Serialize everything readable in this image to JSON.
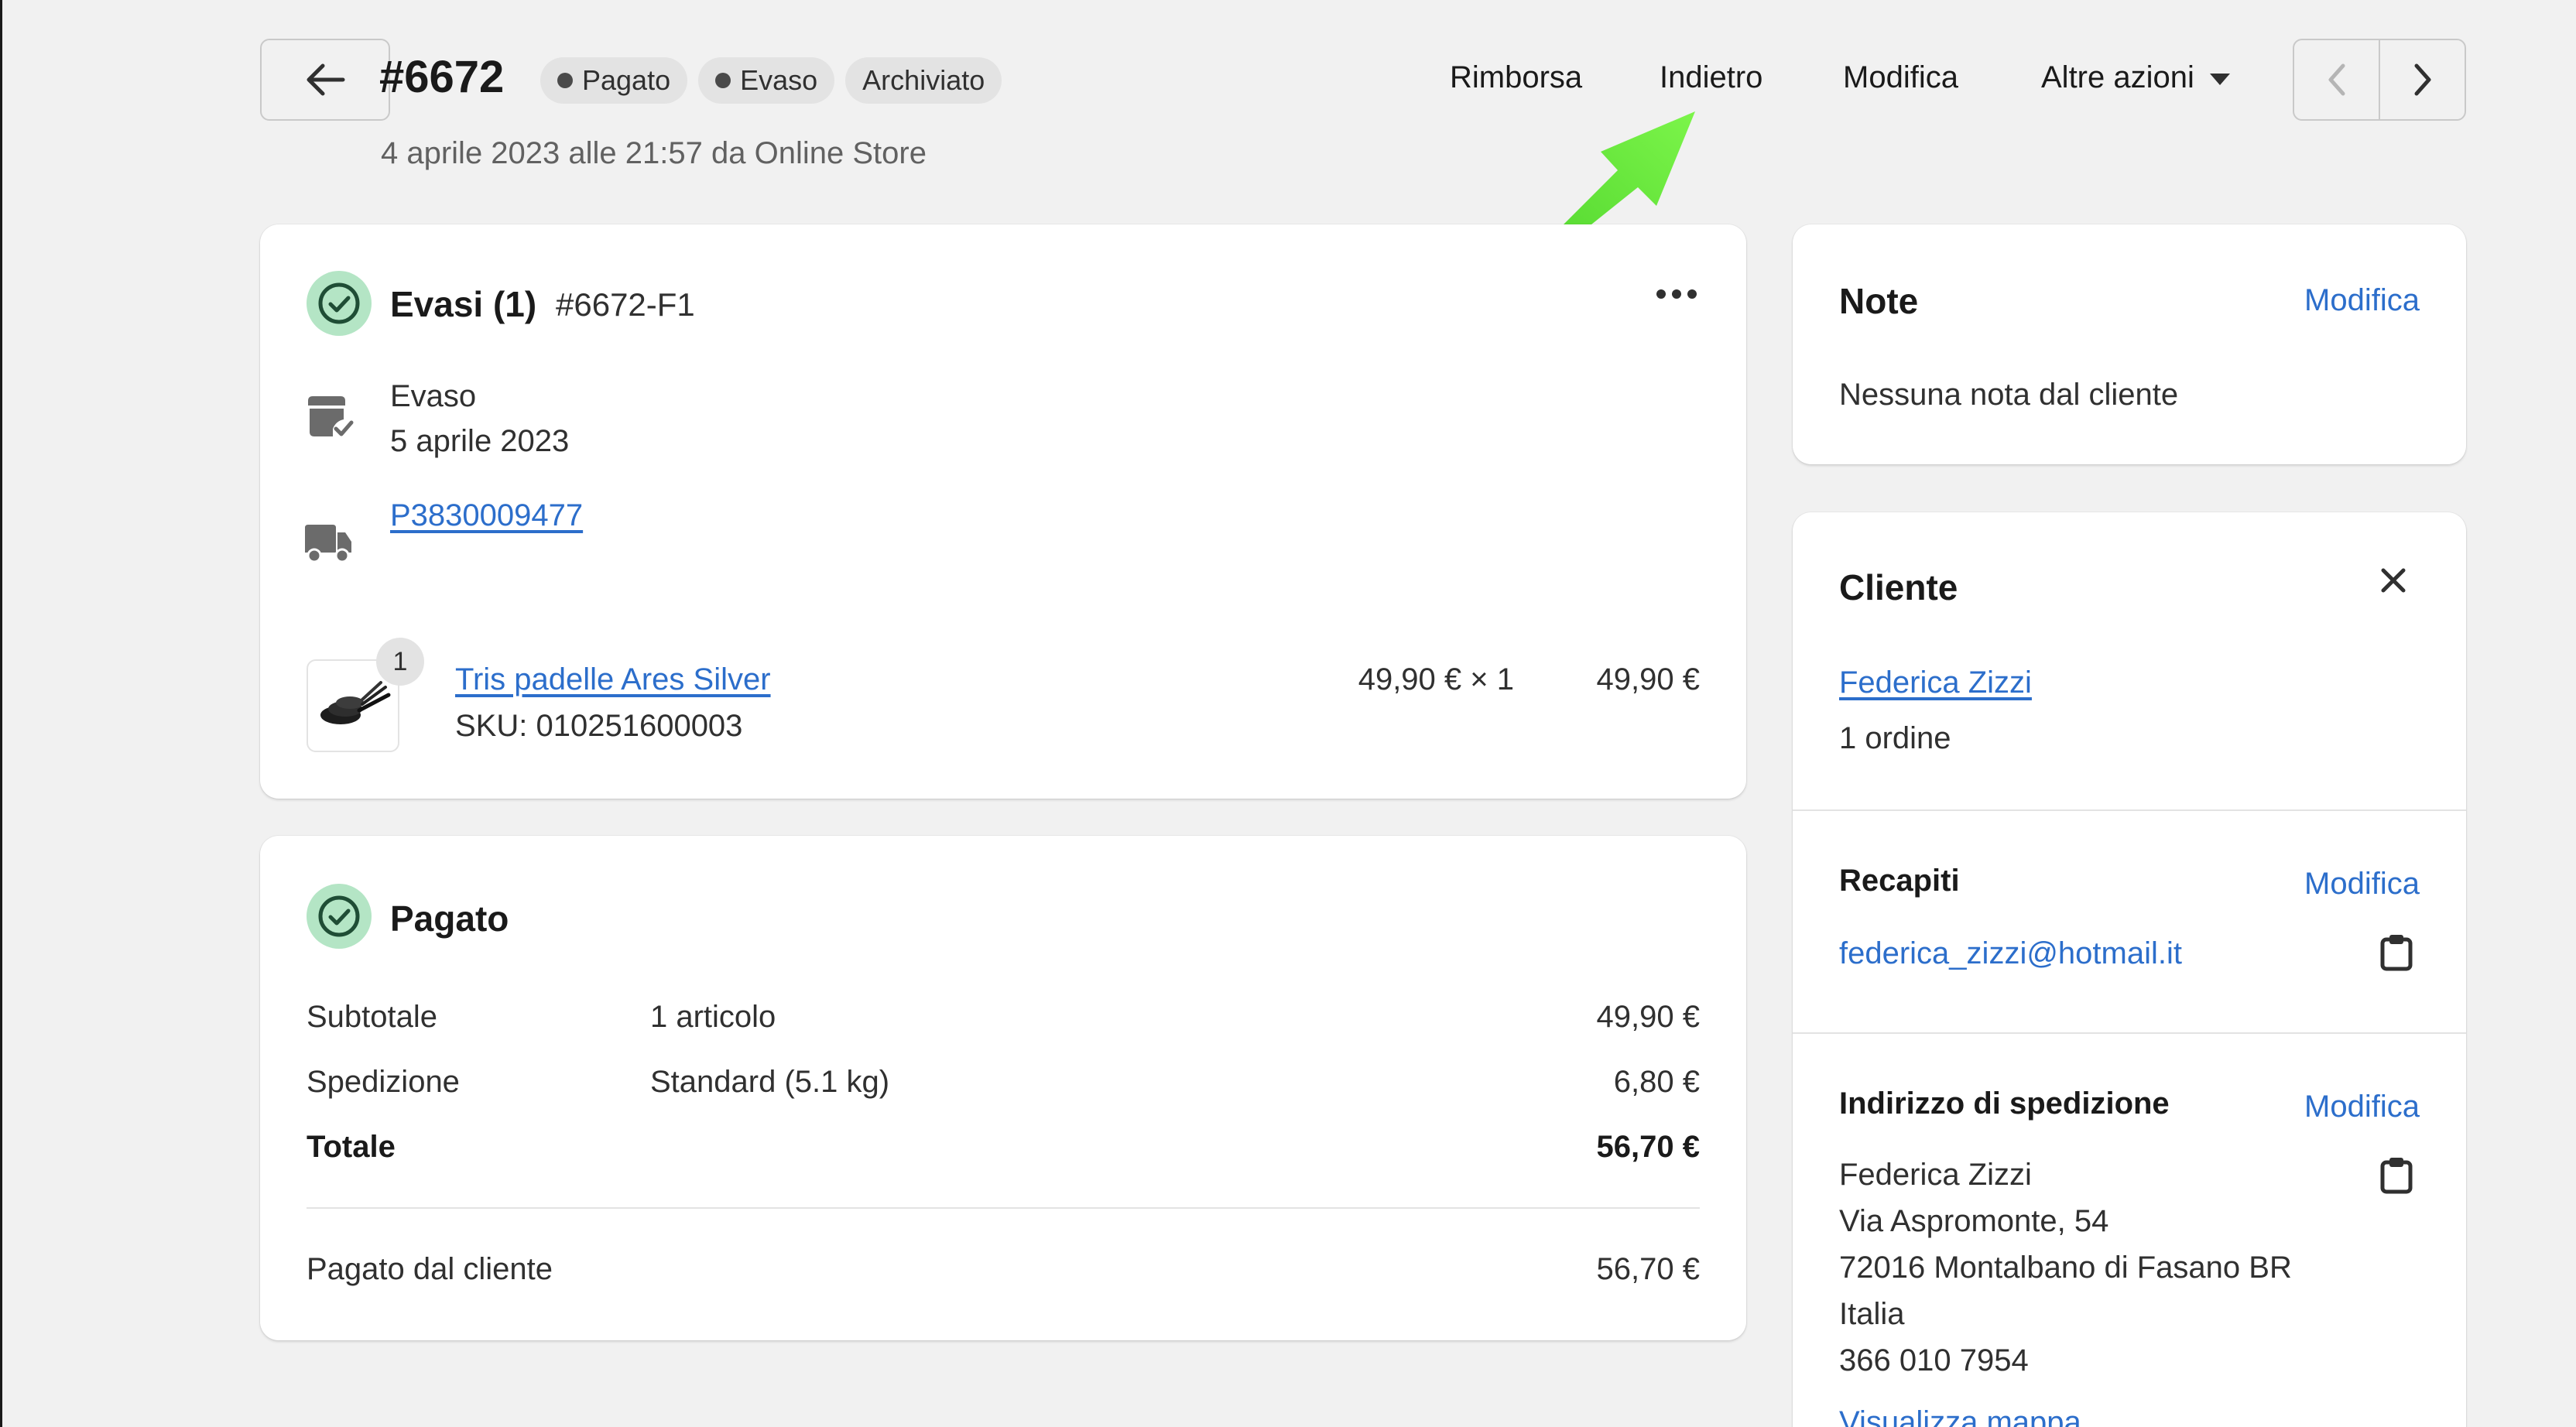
{
  "header": {
    "order_number": "#6672",
    "badges": [
      {
        "label": "Pagato",
        "dot": true
      },
      {
        "label": "Evaso",
        "dot": true
      },
      {
        "label": "Archiviato",
        "dot": false
      }
    ],
    "subtitle": "4 aprile 2023 alle 21:57 da Online Store",
    "actions": {
      "refund": "Rimborsa",
      "back": "Indietro",
      "edit": "Modifica",
      "more": "Altre azioni"
    }
  },
  "fulfillment": {
    "title": "Evasi (1)",
    "fulfillment_id": "#6672-F1",
    "status_label": "Evaso",
    "status_date": "5 aprile 2023",
    "tracking_number": "P3830009477",
    "item": {
      "quantity_badge": "1",
      "name": "Tris padelle Ares Silver",
      "sku": "SKU: 010251600003",
      "unit_price": "49,90 € × 1",
      "total": "49,90 €"
    }
  },
  "payment": {
    "title": "Pagato",
    "rows": [
      {
        "label": "Subtotale",
        "detail": "1 articolo",
        "amount": "49,90 €"
      },
      {
        "label": "Spedizione",
        "detail": "Standard (5.1 kg)",
        "amount": "6,80 €"
      },
      {
        "label": "Totale",
        "detail": "",
        "amount": "56,70 €"
      }
    ],
    "paid_by_customer_label": "Pagato dal cliente",
    "paid_by_customer_amount": "56,70 €"
  },
  "note": {
    "title": "Note",
    "edit": "Modifica",
    "text": "Nessuna nota dal cliente"
  },
  "customer": {
    "title": "Cliente",
    "name": "Federica Zizzi",
    "orders": "1 ordine",
    "contacts_title": "Recapiti",
    "contacts_edit": "Modifica",
    "email": "federica_zizzi@hotmail.it",
    "shipping_title": "Indirizzo di spedizione",
    "shipping_edit": "Modifica",
    "address_lines": [
      "Federica Zizzi",
      "Via Aspromonte, 54",
      "72016 Montalbano di Fasano BR",
      "Italia",
      "366 010 7954"
    ],
    "map_link": "Visualizza mappa"
  },
  "colors": {
    "accent_link": "#2c6ecb",
    "success_circle": "#b4e5c5",
    "annotation_arrow": "#5fe03a"
  },
  "icons": [
    "back-arrow-icon",
    "chevron-left-icon",
    "chevron-right-icon",
    "caret-down-icon",
    "check-circle-icon",
    "fulfilled-box-icon",
    "truck-icon",
    "more-horizontal-icon",
    "close-icon",
    "clipboard-icon",
    "pan-product-image"
  ]
}
